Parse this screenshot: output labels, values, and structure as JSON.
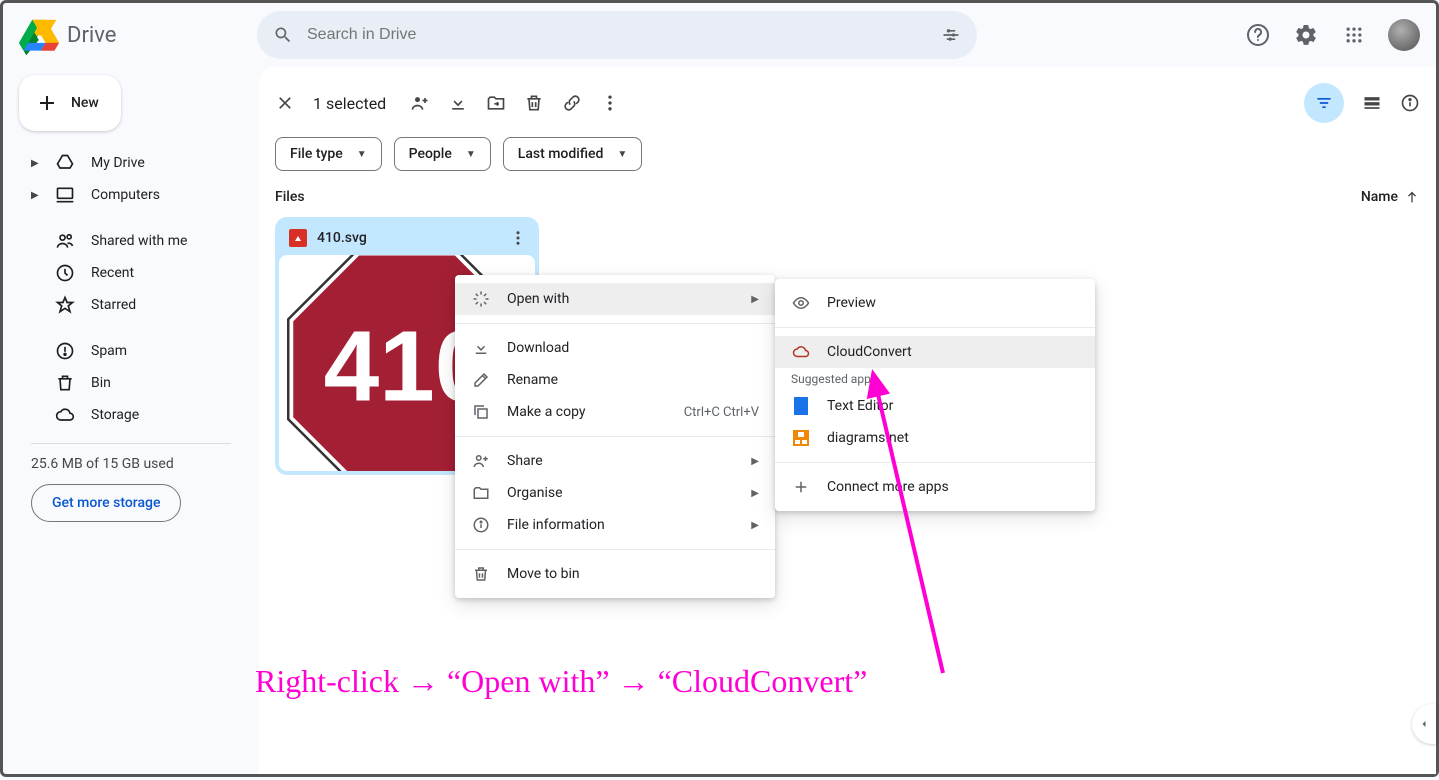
{
  "app": {
    "name": "Drive"
  },
  "search": {
    "placeholder": "Search in Drive"
  },
  "sidebar": {
    "new_label": "New",
    "items": [
      {
        "label": "My Drive",
        "has_caret": true,
        "icon": "mydrive"
      },
      {
        "label": "Computers",
        "has_caret": true,
        "icon": "computers"
      },
      {
        "label": "Shared with me",
        "icon": "shared"
      },
      {
        "label": "Recent",
        "icon": "recent"
      },
      {
        "label": "Starred",
        "icon": "starred"
      },
      {
        "label": "Spam",
        "icon": "spam"
      },
      {
        "label": "Bin",
        "icon": "bin"
      },
      {
        "label": "Storage",
        "icon": "storage"
      }
    ],
    "storage_text": "25.6 MB of 15 GB used",
    "storage_button": "Get more storage"
  },
  "toolbar": {
    "selection_count": "1 selected",
    "chips": [
      {
        "label": "File type"
      },
      {
        "label": "People"
      },
      {
        "label": "Last modified"
      }
    ]
  },
  "files": {
    "section_label": "Files",
    "sort_label": "Name",
    "items": [
      {
        "name": "410.svg",
        "thumb_text": "410"
      }
    ]
  },
  "context_menu": {
    "open_with": "Open with",
    "download": "Download",
    "rename": "Rename",
    "make_copy": "Make a copy",
    "make_copy_shortcut": "Ctrl+C Ctrl+V",
    "share": "Share",
    "organise": "Organise",
    "file_info": "File information",
    "move_bin": "Move to bin"
  },
  "submenu": {
    "preview": "Preview",
    "cloudconvert": "CloudConvert",
    "suggested_label": "Suggested apps",
    "text_editor": "Text Editor",
    "diagrams": "diagrams.net",
    "connect_more": "Connect more apps"
  },
  "annotation": {
    "text": "Right-click → “Open with” → “CloudConvert”"
  }
}
